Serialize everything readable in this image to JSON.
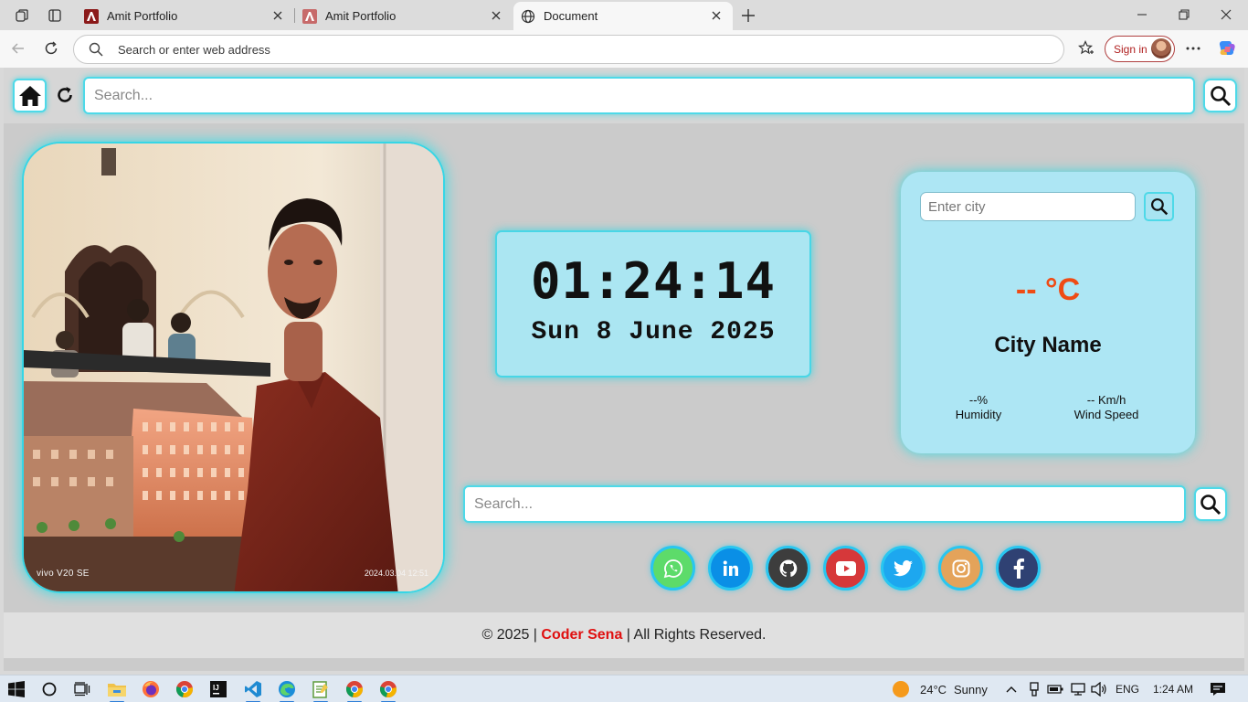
{
  "browser": {
    "tabs": [
      {
        "title": "Amit Portfolio",
        "active": false
      },
      {
        "title": "Amit Portfolio",
        "active": false
      },
      {
        "title": "Document",
        "active": true
      }
    ],
    "address_placeholder": "Search or enter web address",
    "sign_in_label": "Sign in"
  },
  "page": {
    "top_search_placeholder": "Search...",
    "photo": {
      "caption_left": "vivo V20 SE",
      "caption_right": "2024.03.04 12:51"
    },
    "clock": {
      "time": "01:24:14",
      "date": "Sun 8 June 2025"
    },
    "weather": {
      "city_placeholder": "Enter city",
      "temperature": "-- °C",
      "city_name": "City Name",
      "humidity_value": "--%",
      "humidity_label": "Humidity",
      "wind_value": "-- Km/h",
      "wind_label": "Wind Speed",
      "temp_color": "#ef4b14"
    },
    "bottom_search_placeholder": "Search...",
    "social_links": [
      {
        "name": "whatsapp",
        "color": "#5ddb6a"
      },
      {
        "name": "linkedin",
        "color": "#0a8fe6"
      },
      {
        "name": "github",
        "color": "#3d3d3d"
      },
      {
        "name": "youtube",
        "color": "#d6383a"
      },
      {
        "name": "twitter",
        "color": "#1da7ef"
      },
      {
        "name": "instagram",
        "color": "#e4a35a"
      },
      {
        "name": "facebook",
        "color": "#2f4173"
      }
    ],
    "footer": {
      "prefix": "© 2025 |",
      "brand": "Coder Sena",
      "suffix": "| All Rights Reserved."
    },
    "accent_color": "#4ed9e8"
  },
  "taskbar": {
    "weather_temp": "24°C",
    "weather_cond": "Sunny",
    "language": "ENG",
    "clock": "1:24 AM"
  }
}
